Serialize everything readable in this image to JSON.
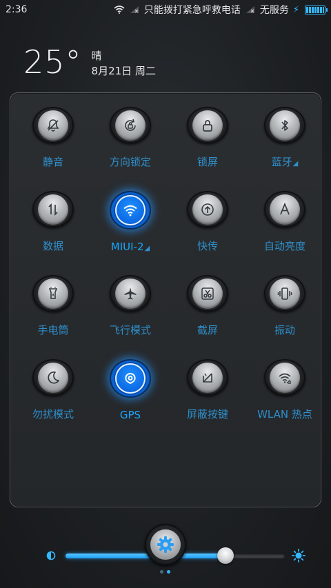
{
  "status": {
    "time": "2:36",
    "carrier": "只能拨打紧急呼救电话",
    "carrier2": "无服务",
    "battery_level": 1.0
  },
  "weather": {
    "temperature": "25°",
    "condition": "晴",
    "date": "8月21日 周二"
  },
  "toggles": [
    {
      "label": "静音",
      "icon": "bell-off-icon",
      "active": false
    },
    {
      "label": "方向锁定",
      "icon": "rotation-lock-icon",
      "active": false
    },
    {
      "label": "锁屏",
      "icon": "lock-icon",
      "active": false
    },
    {
      "label": "蓝牙",
      "icon": "bluetooth-icon",
      "active": false
    },
    {
      "label": "数据",
      "icon": "data-arrows-icon",
      "active": false
    },
    {
      "label": "MIUI-2",
      "icon": "wifi-icon",
      "active": true
    },
    {
      "label": "快传",
      "icon": "upload-icon",
      "active": false
    },
    {
      "label": "自动亮度",
      "icon": "letter-a-icon",
      "active": false
    },
    {
      "label": "手电筒",
      "icon": "flashlight-icon",
      "active": false
    },
    {
      "label": "飞行模式",
      "icon": "airplane-icon",
      "active": false
    },
    {
      "label": "截屏",
      "icon": "scissors-icon",
      "active": false
    },
    {
      "label": "振动",
      "icon": "vibrate-icon",
      "active": false
    },
    {
      "label": "勿扰模式",
      "icon": "moon-icon",
      "active": false
    },
    {
      "label": "GPS",
      "icon": "gps-icon",
      "active": true
    },
    {
      "label": "屏蔽按键",
      "icon": "block-keys-icon",
      "active": false
    },
    {
      "label": "WLAN 热点",
      "icon": "hotspot-icon",
      "active": false
    }
  ],
  "brightness": {
    "level": 0.73
  },
  "colors": {
    "accent": "#1aa7ff",
    "label": "#2e8fcb"
  }
}
